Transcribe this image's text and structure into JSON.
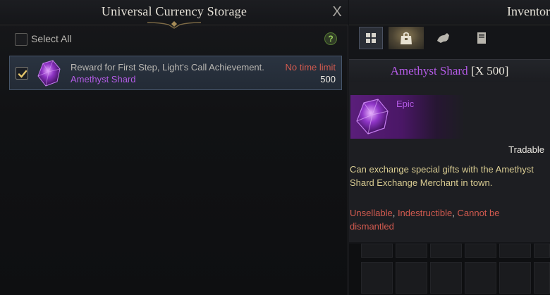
{
  "storage": {
    "title": "Universal Currency Storage",
    "close_glyph": "X",
    "select_all_label": "Select All",
    "help_glyph": "?",
    "rows": [
      {
        "checked": true,
        "description": "Reward for First Step, Light's Call Achievement.",
        "item_name": "Amethyst Shard",
        "time_limit": "No time limit",
        "count": "500",
        "icon": "amethyst-gem-icon"
      }
    ]
  },
  "inventory": {
    "title": "Inventory",
    "tabs": [
      {
        "name": "grid-view-icon",
        "active": true
      },
      {
        "name": "bag-icon",
        "active": false
      },
      {
        "name": "mount-icon",
        "active": false
      },
      {
        "name": "book-icon",
        "active": false
      }
    ],
    "tooltip": {
      "item_name": "Amethyst Shard",
      "quantity": "[X 500]",
      "grade": "Epic",
      "tradable": "Tradable",
      "description": "Can exchange special gifts with the Amethyst Shard Exchange Merchant in town.",
      "flags": [
        "Unsellable",
        "Indestructible",
        "Cannot be dismantled"
      ],
      "separator": ", "
    }
  },
  "colors": {
    "epic_purple": "#b45be6",
    "warning_red": "#d25a4f",
    "description_gold": "#d9cc92",
    "title_text": "#e6e2d8",
    "selected_row": "#2a3340"
  }
}
